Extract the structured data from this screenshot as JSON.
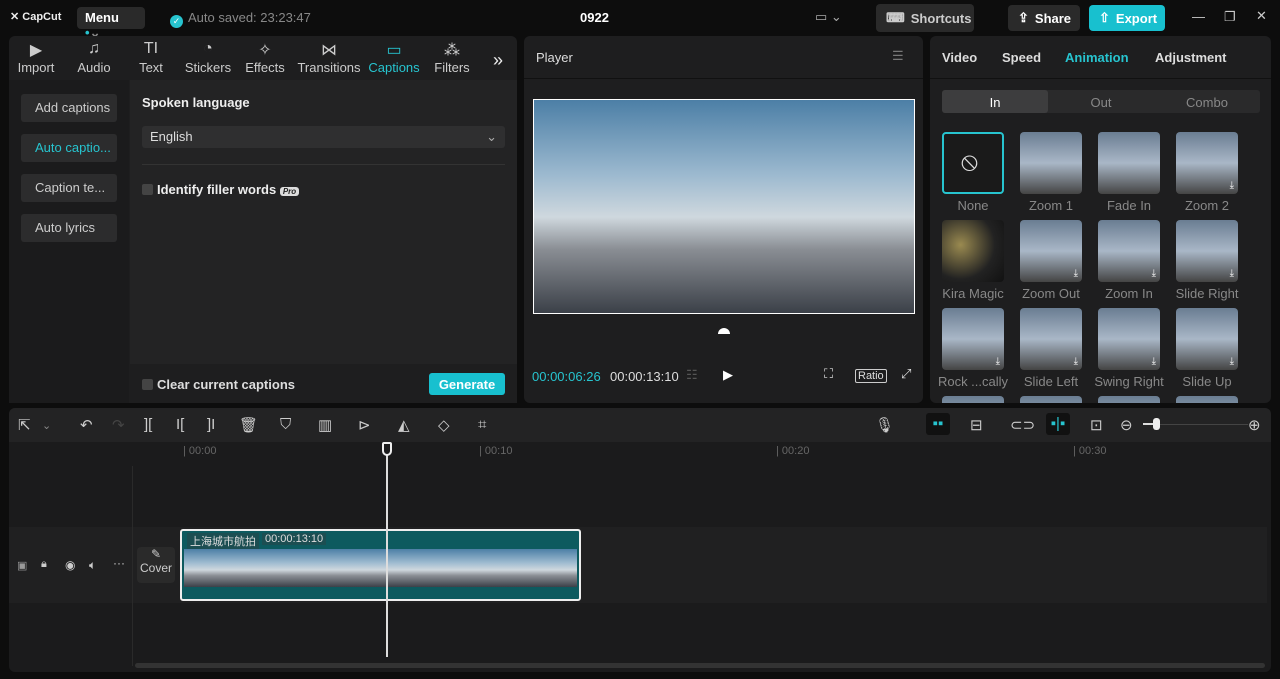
{
  "app": {
    "logo": "CapCut",
    "menu": "Menu",
    "autosave": "Auto saved: 23:23:47",
    "project_title": "0922",
    "shortcuts": "Shortcuts",
    "share": "Share",
    "export": "Export"
  },
  "media_tabs": [
    {
      "label": "Import",
      "icon": "▶"
    },
    {
      "label": "Audio",
      "icon": "♫"
    },
    {
      "label": "Text",
      "icon": "TI"
    },
    {
      "label": "Stickers",
      "icon": "◔"
    },
    {
      "label": "Effects",
      "icon": "✧"
    },
    {
      "label": "Transitions",
      "icon": "⋈"
    },
    {
      "label": "Captions",
      "icon": "▭"
    },
    {
      "label": "Filters",
      "icon": "⁂"
    }
  ],
  "captions_menu": [
    "Add captions",
    "Auto captio...",
    "Caption te...",
    "Auto lyrics"
  ],
  "captions": {
    "spoken_language_label": "Spoken language",
    "language": "English",
    "filler_words": "Identify filler words",
    "pro_badge": "Pro",
    "clear_captions": "Clear current captions",
    "generate": "Generate"
  },
  "player": {
    "title": "Player",
    "current_time": "00:00:06:26",
    "total_time": "00:00:13:10",
    "ratio": "Ratio"
  },
  "right_tabs": [
    "Video",
    "Speed",
    "Animation",
    "Adjustment"
  ],
  "anim_tabs": [
    "In",
    "Out",
    "Combo"
  ],
  "animations": [
    "None",
    "Zoom 1",
    "Fade In",
    "Zoom 2",
    "Kira Magic",
    "Zoom Out",
    "Zoom In",
    "Slide Right",
    "Rock ...cally",
    "Slide Left",
    "Swing Right",
    "Slide Up"
  ],
  "ruler": [
    "00:00",
    "00:10",
    "00:20",
    "00:30"
  ],
  "clip": {
    "name": "上海城市航拍",
    "duration": "00:00:13:10"
  },
  "cover": "Cover",
  "colors": {
    "accent": "#27c4cf",
    "clip": "#0d5a5f"
  }
}
